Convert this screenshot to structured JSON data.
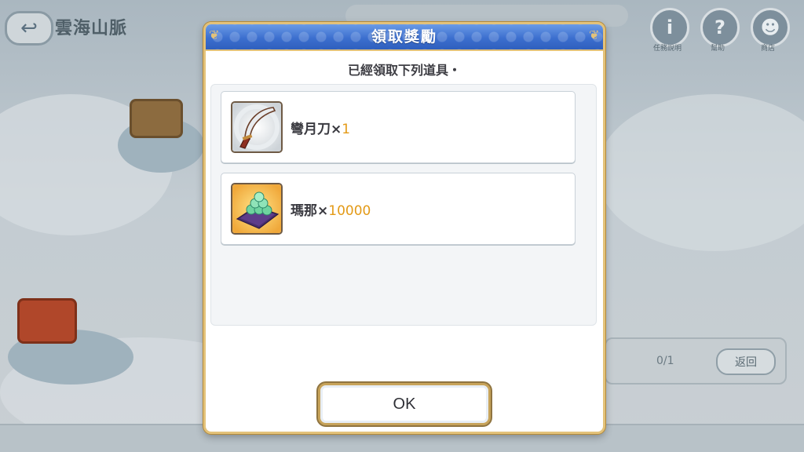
{
  "background": {
    "area_title": "雲海山脈",
    "top_icons": [
      {
        "name": "info-icon",
        "glyph": "i",
        "label": "任務說明"
      },
      {
        "name": "help-icon",
        "glyph": "?",
        "label": "幫助"
      },
      {
        "name": "shop-icon",
        "glyph": "☻",
        "label": "商店"
      }
    ],
    "progress_text": "0/1",
    "return_label": "返回",
    "back_icon": "↩"
  },
  "modal": {
    "title": "領取獎勵",
    "subtitle": "已經領取下列道具・",
    "items": [
      {
        "name": "彎月刀",
        "times": "×",
        "quantity": "1",
        "icon": "crescent-blade-icon"
      },
      {
        "name": "瑪那",
        "times": "×",
        "quantity": "10000",
        "icon": "mana-pile-icon"
      }
    ],
    "ok_label": "OK"
  },
  "colors": {
    "header_blue": "#3c6fcf",
    "frame_gold": "#e3c27a",
    "quantity_orange": "#e39a17"
  }
}
